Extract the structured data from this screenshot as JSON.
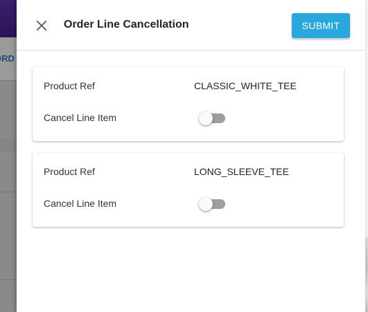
{
  "background": {
    "tab_fragment": "ORD"
  },
  "drawer": {
    "title": "Order Line Cancellation",
    "submit_label": "SUBMIT",
    "close_icon": "close-icon"
  },
  "lines": [
    {
      "product_ref_label": "Product Ref",
      "product_ref_value": "CLASSIC_WHITE_TEE",
      "cancel_label": "Cancel Line Item",
      "cancel_checked": false
    },
    {
      "product_ref_label": "Product Ref",
      "product_ref_value": "LONG_SLEEVE_TEE",
      "cancel_label": "Cancel Line Item",
      "cancel_checked": false
    }
  ],
  "colors": {
    "submit_bg": "#29a8e0",
    "header_bg": "#3d1e6d",
    "toggle_track_off": "#9e9e9e"
  }
}
